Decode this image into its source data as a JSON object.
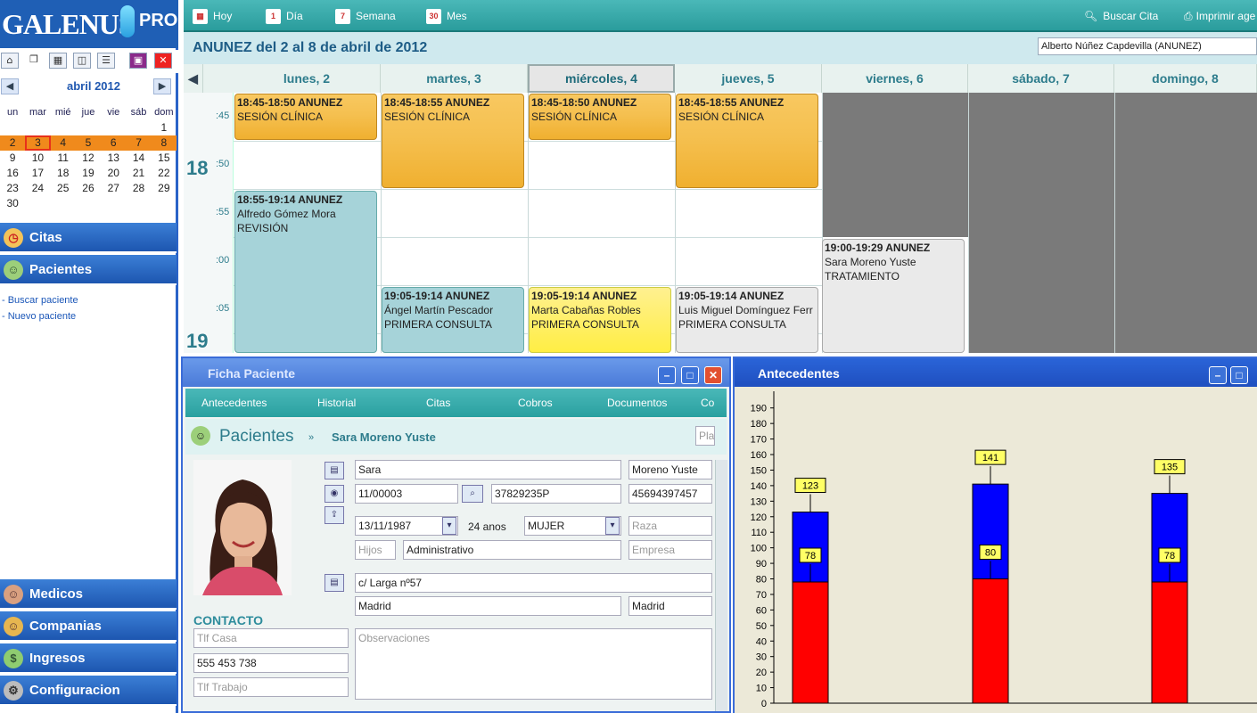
{
  "app": {
    "logo": "GALENUS",
    "logo_sub": "PRO"
  },
  "left_toolbar_icons": [
    "home-icon",
    "copy-icon",
    "grid-icon",
    "split-icon",
    "list-icon",
    "save-icon",
    "close-icon"
  ],
  "calendar": {
    "month_label": "abril 2012",
    "weekday_headers": [
      "un",
      "mar",
      "mié",
      "jue",
      "vie",
      "sáb",
      "dom"
    ],
    "weeks": [
      [
        "",
        "",
        "",
        "",
        "",
        "",
        "1"
      ],
      [
        "2",
        "3",
        "4",
        "5",
        "6",
        "7",
        "8"
      ],
      [
        "9",
        "10",
        "11",
        "12",
        "13",
        "14",
        "15"
      ],
      [
        "16",
        "17",
        "18",
        "19",
        "20",
        "21",
        "22"
      ],
      [
        "23",
        "24",
        "25",
        "26",
        "27",
        "28",
        "29"
      ],
      [
        "30",
        "",
        "",
        "",
        "",
        "",
        ""
      ]
    ],
    "highlight_week": 1,
    "today": "3"
  },
  "nav": {
    "citas": "Citas",
    "pacientes": "Pacientes",
    "pacientes_links": [
      "- Buscar paciente",
      "- Nuevo paciente"
    ],
    "medicos": "Medicos",
    "companias": "Companias",
    "ingresos": "Ingresos",
    "configuracion": "Configuracion"
  },
  "toolbar": {
    "hoy": "Hoy",
    "dia": "Día",
    "semana": "Semana",
    "mes": "Mes",
    "buscar": "Buscar Cita",
    "imprimir": "Imprimir age",
    "dia_icon": "1",
    "semana_icon": "7",
    "mes_icon": "30"
  },
  "range": {
    "title": "ANUNEZ del 2 al 8 de abril de 2012",
    "doctor": "Alberto Núñez Capdevilla (ANUNEZ)"
  },
  "week": {
    "days": [
      "lunes, 2",
      "martes, 3",
      "miércoles, 4",
      "jueves, 5",
      "viernes, 6",
      "sábado, 7",
      "domingo, 8"
    ],
    "current_day": 2,
    "slots": [
      ":45",
      ":50",
      ":55",
      ":00",
      ":05"
    ],
    "hours": [
      "18",
      "19"
    ],
    "appointments": [
      {
        "time": "18:45-18:50 ANUNEZ",
        "line2": "SESIÓN CLÍNICA",
        "line3": "",
        "style": "or"
      },
      {
        "time": "18:45-18:55 ANUNEZ",
        "line2": "SESIÓN CLÍNICA",
        "line3": "",
        "style": "or"
      },
      {
        "time": "18:45-18:50 ANUNEZ",
        "line2": "SESIÓN CLÍNICA",
        "line3": "",
        "style": "or"
      },
      {
        "time": "18:45-18:55 ANUNEZ",
        "line2": "SESIÓN CLÍNICA",
        "line3": "",
        "style": "or"
      },
      {
        "time": "18:55-19:14 ANUNEZ",
        "line2": "Alfredo Gómez Mora",
        "line3": "REVISIÓN",
        "style": "bl"
      },
      {
        "time": "19:05-19:14 ANUNEZ",
        "line2": "Ángel Martín Pescador",
        "line3": "PRIMERA CONSULTA",
        "style": "bl"
      },
      {
        "time": "19:05-19:14 ANUNEZ",
        "line2": "Marta Cabañas Robles",
        "line3": "PRIMERA CONSULTA",
        "style": "yl"
      },
      {
        "time": "19:05-19:14 ANUNEZ",
        "line2": "Luis Miguel Domínguez Ferr",
        "line3": "PRIMERA CONSULTA",
        "style": "wh"
      },
      {
        "time": "19:00-19:29 ANUNEZ",
        "line2": "Sara Moreno Yuste",
        "line3": "TRATAMIENTO",
        "style": "wh"
      }
    ]
  },
  "ficha": {
    "title": "Ficha Paciente",
    "tabs": [
      "Antecedentes",
      "Historial",
      "Citas",
      "Cobros",
      "Documentos",
      "Co"
    ],
    "section": "Pacientes",
    "patient": "Sara Moreno Yuste",
    "search_placeholder": "Pla",
    "nombre": "Sara",
    "apellidos": "Moreno Yuste",
    "codigo": "11/00003",
    "dni": "37829235P",
    "telefono_extra": "45694397457",
    "fecha_nac": "13/11/1987",
    "edad": "24 anos",
    "sexo": "MUJER",
    "raza_ph": "Raza",
    "hijos_ph": "Hijos",
    "profesion": "Administrativo",
    "empresa_ph": "Empresa",
    "direccion": "c/ Larga nº57",
    "ciudad": "Madrid",
    "provincia": "Madrid",
    "contacto": "CONTACTO",
    "tel_casa_ph": "Tlf Casa",
    "tel_movil": "555 453 738",
    "tel_trabajo_ph": "Tlf Trabajo",
    "observaciones_ph": "Observaciones"
  },
  "antecedentes": {
    "title": "Antecedentes"
  },
  "chart_data": {
    "type": "bar",
    "title": "",
    "xlabel": "",
    "ylabel": "",
    "ylim": [
      0,
      195
    ],
    "yticks": [
      0,
      10,
      20,
      30,
      40,
      50,
      60,
      70,
      80,
      90,
      100,
      110,
      120,
      130,
      140,
      150,
      160,
      170,
      180,
      190
    ],
    "categories": [
      "",
      "",
      ""
    ],
    "series": [
      {
        "values": [
          78,
          80,
          78
        ],
        "color": "#ff0000"
      },
      {
        "values": [
          123,
          141,
          135
        ],
        "color": "#0000ff"
      }
    ],
    "labels_lower": [
      "78",
      "80",
      "78"
    ],
    "labels_upper": [
      "123",
      "141",
      "135"
    ],
    "grid": false,
    "legend": "none",
    "stacked": false
  }
}
